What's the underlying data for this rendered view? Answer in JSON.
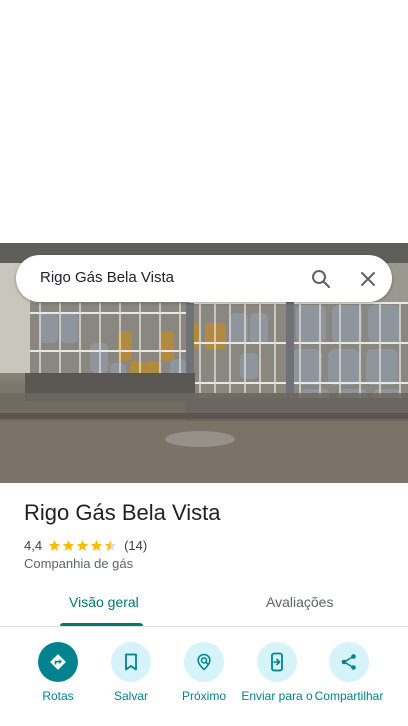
{
  "search": {
    "query": "Rigo Gás Bela Vista",
    "search_icon": "search-icon",
    "close_icon": "close-icon"
  },
  "place": {
    "name": "Rigo Gás Bela Vista",
    "rating": "4,4",
    "rating_value": 4.4,
    "review_count": "(14)",
    "category": "Companhia de gás"
  },
  "tabs": [
    {
      "label": "Visão geral",
      "selected": true
    },
    {
      "label": "Avaliações",
      "selected": false
    }
  ],
  "actions": [
    {
      "label": "Rotas",
      "icon": "directions-icon"
    },
    {
      "label": "Salvar",
      "icon": "bookmark-icon"
    },
    {
      "label": "Próximo",
      "icon": "nearby-icon"
    },
    {
      "label": "Enviar para o",
      "icon": "send-to-phone-icon"
    },
    {
      "label": "Compartilhar",
      "icon": "share-icon"
    }
  ],
  "colors": {
    "accent": "#00838f",
    "tab_accent": "#00796b",
    "star": "#fbbc04",
    "action_bg": "#d5f3f8"
  }
}
